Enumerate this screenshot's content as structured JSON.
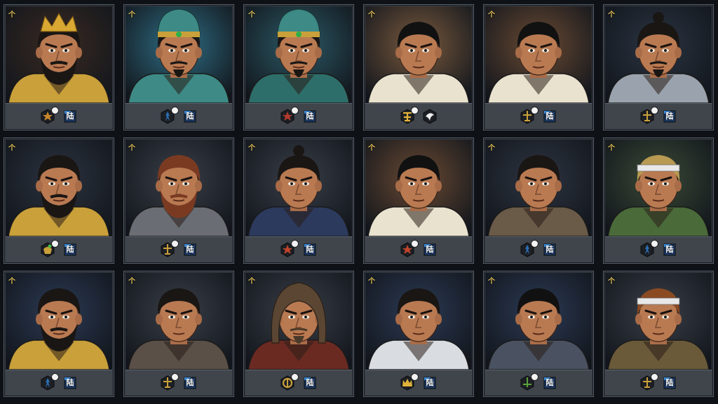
{
  "corner_mark": "个",
  "faction_label": "陆",
  "colors": {
    "frame": "#3b4047",
    "frame_border": "#59606a",
    "gold": "#e9c65a",
    "skin": "#b97a52",
    "hair_black": "#1a1614"
  },
  "cards": [
    {
      "bg": "#3a2a22",
      "hair": "#1a1614",
      "headwear": "gold-crown",
      "armor": "#c9a03a",
      "beard": "full",
      "role_icon": "red-gold-crest",
      "role_color": "#c9862b",
      "faction_icon": "blue-flag"
    },
    {
      "bg": "#2f6f86",
      "hair": "#1a1614",
      "headwear": "teal-hat",
      "armor": "#3d8a86",
      "beard": "goatee",
      "role_icon": "blue-runner",
      "role_color": "#2b6fb3",
      "faction_icon": "blue-flag"
    },
    {
      "bg": "#2c5a67",
      "hair": "#1a1614",
      "headwear": "teal-hat",
      "armor": "#2e6e6a",
      "beard": "goatee",
      "role_icon": "red-star",
      "role_color": "#b33a2b",
      "faction_icon": "blue-flag"
    },
    {
      "bg": "#7a5a3e",
      "hair": "#111",
      "headwear": "none",
      "armor": "#e9e2cf",
      "beard": "none",
      "role_icon": "gold-glyph",
      "role_color": "#e0b23a",
      "faction_icon": "white-bird"
    },
    {
      "bg": "#6a4a33",
      "hair": "#111",
      "headwear": "none",
      "armor": "#e9e2cf",
      "beard": "none",
      "role_icon": "gold-sword",
      "role_color": "#c9a03a",
      "faction_icon": "blue-flag"
    },
    {
      "bg": "#2a3442",
      "hair": "#1a1614",
      "headwear": "topknot",
      "armor": "#9aa3ad",
      "beard": "goatee",
      "role_icon": "gold-sword",
      "role_color": "#c9a03a",
      "faction_icon": "blue-flag"
    },
    {
      "bg": "#2c3340",
      "hair": "#1a1614",
      "headwear": "none",
      "armor": "#c9a03a",
      "beard": "full",
      "role_icon": "green-gold",
      "role_color": "#c9a03a",
      "faction_icon": "blue-flag"
    },
    {
      "bg": "#3a3f48",
      "hair": "#7a3a22",
      "headwear": "none",
      "armor": "#6a6e74",
      "beard": "full",
      "role_icon": "gold-sword",
      "role_color": "#c9a03a",
      "faction_icon": "blue-flag"
    },
    {
      "bg": "#3a3f48",
      "hair": "#1a1614",
      "headwear": "topknot",
      "armor": "#2c3a5e",
      "beard": "none",
      "role_icon": "red-star",
      "role_color": "#c0442b",
      "faction_icon": "blue-flag"
    },
    {
      "bg": "#6a4a33",
      "hair": "#111",
      "headwear": "none",
      "armor": "#e9e2cf",
      "beard": "none",
      "role_icon": "red-star",
      "role_color": "#c0442b",
      "faction_icon": "blue-flag"
    },
    {
      "bg": "#2e3542",
      "hair": "#1a1614",
      "headwear": "none",
      "armor": "#6a5a48",
      "beard": "none",
      "role_icon": "blue-runner",
      "role_color": "#2b6fb3",
      "faction_icon": "blue-flag"
    },
    {
      "bg": "#3a4a36",
      "hair": "#b89a52",
      "headwear": "headband",
      "armor": "#4a6a3a",
      "beard": "none",
      "role_icon": "blue-runner",
      "role_color": "#2b6fb3",
      "faction_icon": "blue-flag"
    },
    {
      "bg": "#2c3a55",
      "hair": "#1a1614",
      "headwear": "none",
      "armor": "#c9a03a",
      "beard": "full",
      "role_icon": "blue-runner",
      "role_color": "#2b6fb3",
      "faction_icon": "blue-flag"
    },
    {
      "bg": "#3a3f48",
      "hair": "#1a1614",
      "headwear": "none",
      "armor": "#5a5048",
      "beard": "none",
      "role_icon": "gold-sword",
      "role_color": "#c9a03a",
      "faction_icon": "blue-flag"
    },
    {
      "bg": "#3a3f48",
      "hair": "#4a3a2a",
      "headwear": "hood",
      "armor": "#6a2a22",
      "beard": "goatee",
      "role_icon": "gold-ring",
      "role_color": "#c9a03a",
      "faction_icon": "blue-flag"
    },
    {
      "bg": "#2c3a55",
      "hair": "#1a1614",
      "headwear": "none",
      "armor": "#d9dde2",
      "beard": "none",
      "role_icon": "gold-crown",
      "role_color": "#e0b23a",
      "faction_icon": "blue-flag"
    },
    {
      "bg": "#2c3a55",
      "hair": "#111",
      "headwear": "none",
      "armor": "#4a5262",
      "beard": "none",
      "role_icon": "green-sword",
      "role_color": "#5aa03a",
      "faction_icon": "blue-flag"
    },
    {
      "bg": "#3a3f48",
      "hair": "#8a4a22",
      "headwear": "headband",
      "armor": "#6a5a3a",
      "beard": "none",
      "role_icon": "gold-sword",
      "role_color": "#c9a03a",
      "faction_icon": "blue-flag"
    }
  ]
}
